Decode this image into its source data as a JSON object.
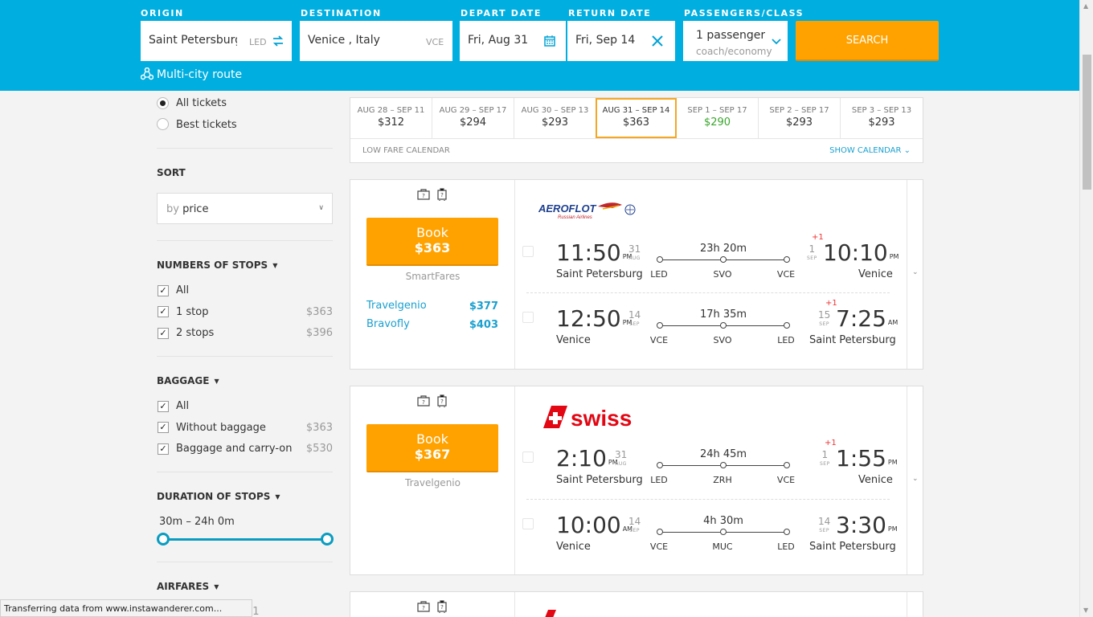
{
  "search": {
    "origin": {
      "label": "ORIGIN",
      "value": "Saint Petersburg",
      "code": "LED"
    },
    "destination": {
      "label": "DESTINATION",
      "value": "Venice , Italy",
      "code": "VCE"
    },
    "depart": {
      "label": "DEPART DATE",
      "value": "Fri, Aug 31"
    },
    "return": {
      "label": "RETURN DATE",
      "value": "Fri, Sep 14"
    },
    "passengers": {
      "label": "PASSENGERS/CLASS",
      "value": "1 passenger",
      "class": "coach/economy"
    },
    "button": "SEARCH",
    "multi_city": "Multi-city route"
  },
  "sidebar": {
    "ticket_options": [
      {
        "label": "All tickets",
        "selected": true
      },
      {
        "label": "Best tickets",
        "selected": false
      }
    ],
    "sort": {
      "title": "SORT",
      "prefix": "by",
      "value": "price"
    },
    "stops": {
      "title": "NUMBERS OF STOPS",
      "items": [
        {
          "label": "All",
          "price": ""
        },
        {
          "label": "1 stop",
          "price": "$363"
        },
        {
          "label": "2 stops",
          "price": "$396"
        }
      ]
    },
    "baggage": {
      "title": "BAGGAGE",
      "items": [
        {
          "label": "All",
          "price": ""
        },
        {
          "label": "Without baggage",
          "price": "$363"
        },
        {
          "label": "Baggage and carry-on",
          "price": "$530"
        }
      ]
    },
    "duration": {
      "title": "DURATION OF STOPS",
      "range": "30m – 24h 0m",
      "min_fraction": 0.0,
      "max_fraction": 1.0
    },
    "airfares": {
      "title": "AIRFARES",
      "partial": "31"
    }
  },
  "calendar": {
    "cells": [
      {
        "dates": "AUG 28 – SEP 11",
        "price": "$312",
        "state": ""
      },
      {
        "dates": "AUG 29 – SEP 17",
        "price": "$294",
        "state": ""
      },
      {
        "dates": "AUG 30 – SEP 13",
        "price": "$293",
        "state": ""
      },
      {
        "dates": "AUG 31 – SEP 14",
        "price": "$363",
        "state": "sel"
      },
      {
        "dates": "SEP 1 – SEP 17",
        "price": "$290",
        "state": "green"
      },
      {
        "dates": "SEP 2 – SEP 17",
        "price": "$293",
        "state": ""
      },
      {
        "dates": "SEP 3 – SEP 13",
        "price": "$293",
        "state": ""
      }
    ],
    "footer_left": "LOW FARE CALENDAR",
    "footer_right": "SHOW CALENDAR"
  },
  "tickets": [
    {
      "airline": "AEROFLOT",
      "airline_sub": "Russian Airlines",
      "book": "Book",
      "price": "$363",
      "agency": "SmartFares",
      "alts": [
        {
          "name": "Travelgenio",
          "price": "$377"
        },
        {
          "name": "Bravofly",
          "price": "$403"
        }
      ],
      "segments": [
        {
          "dep_time": "11:50",
          "dep_ampm": "PM",
          "dep_day": "31",
          "dep_mon": "AUG",
          "dep_city": "Saint Petersburg",
          "duration": "23h 20m",
          "airports": [
            "LED",
            "SVO",
            "VCE"
          ],
          "plus": "+1",
          "arr_day": "1",
          "arr_mon": "SEP",
          "arr_time": "10:10",
          "arr_ampm": "PM",
          "arr_city": "Venice"
        },
        {
          "dep_time": "12:50",
          "dep_ampm": "PM",
          "dep_day": "14",
          "dep_mon": "SEP",
          "dep_city": "Venice",
          "duration": "17h 35m",
          "airports": [
            "VCE",
            "SVO",
            "LED"
          ],
          "plus": "+1",
          "arr_day": "15",
          "arr_mon": "SEP",
          "arr_time": "7:25",
          "arr_ampm": "AM",
          "arr_city": "Saint Petersburg"
        }
      ]
    },
    {
      "airline": "swiss",
      "book": "Book",
      "price": "$367",
      "agency": "Travelgenio",
      "segments": [
        {
          "dep_time": "2:10",
          "dep_ampm": "PM",
          "dep_day": "31",
          "dep_mon": "AUG",
          "dep_city": "Saint Petersburg",
          "duration": "24h 45m",
          "airports": [
            "LED",
            "ZRH",
            "VCE"
          ],
          "plus": "+1",
          "arr_day": "1",
          "arr_mon": "SEP",
          "arr_time": "1:55",
          "arr_ampm": "PM",
          "arr_city": "Venice"
        },
        {
          "dep_time": "10:00",
          "dep_ampm": "AM",
          "dep_day": "14",
          "dep_mon": "SEP",
          "dep_city": "Venice",
          "duration": "4h 30m",
          "airports": [
            "VCE",
            "MUC",
            "LED"
          ],
          "plus": "",
          "arr_day": "14",
          "arr_mon": "SEP",
          "arr_time": "3:30",
          "arr_ampm": "PM",
          "arr_city": "Saint Petersburg"
        }
      ]
    }
  ],
  "status_bar": "Transferring data from www.instawanderer.com...",
  "colors": {
    "header": "#00aee0",
    "accent": "#ffa200",
    "link": "#1aa0d0",
    "green": "#3aa52c"
  }
}
